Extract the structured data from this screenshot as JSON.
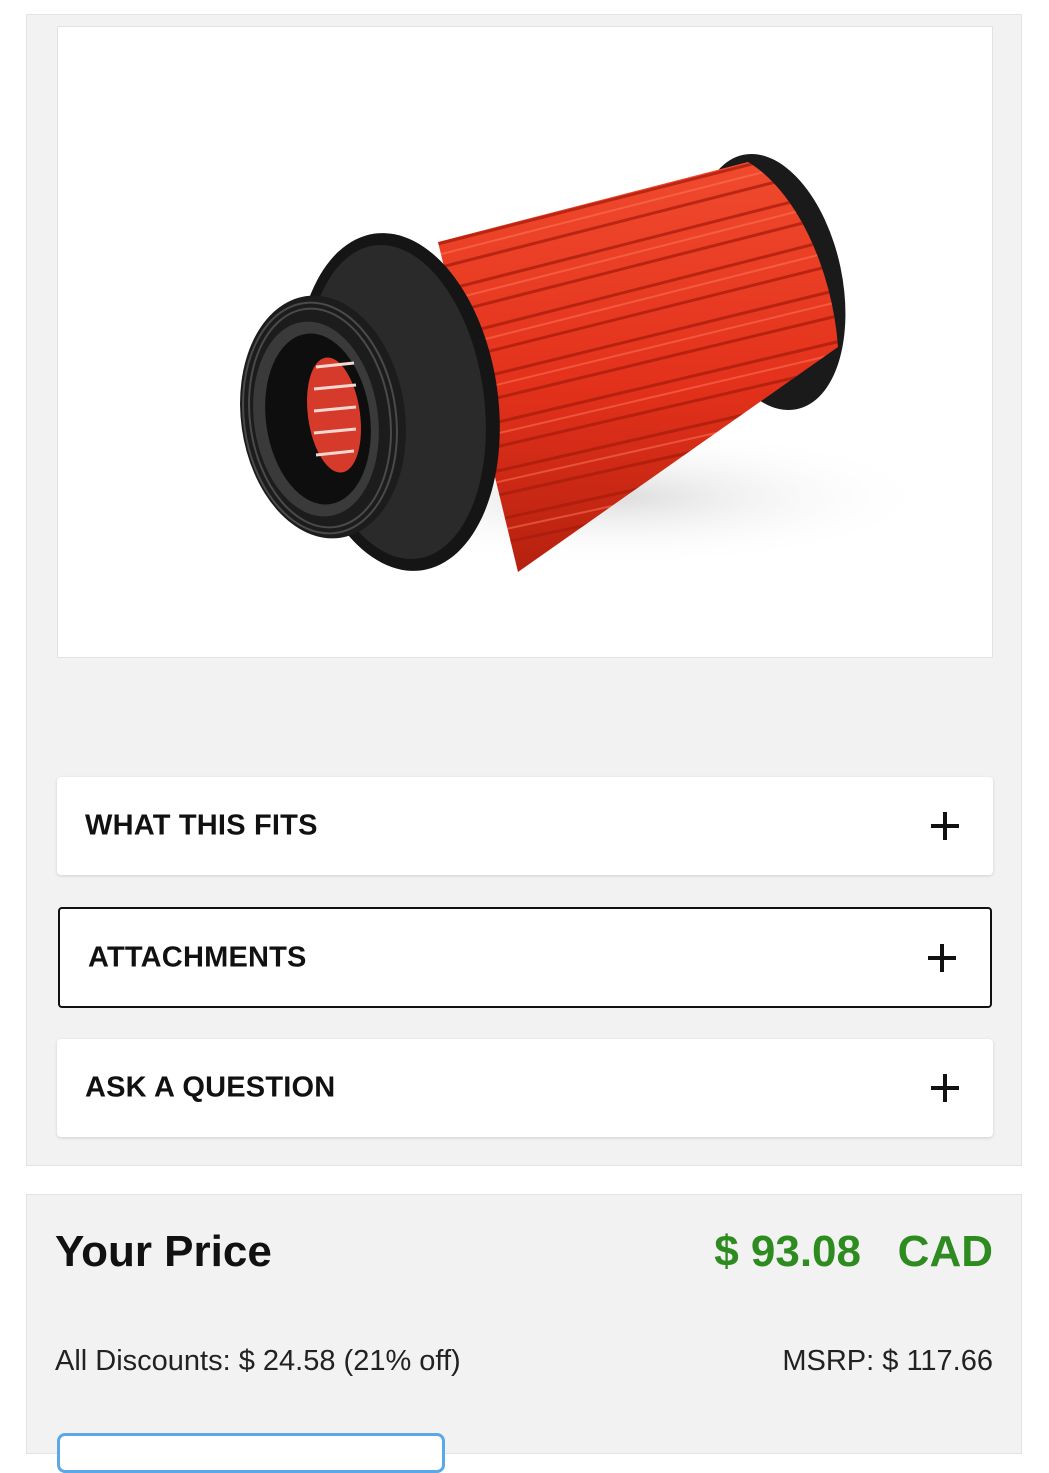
{
  "product": {
    "image_alt": "Red cone air filter",
    "image_icon": "air-filter-product-photo"
  },
  "accordions": {
    "fits": {
      "label": "WHAT THIS FITS",
      "icon": "plus-icon"
    },
    "attachments": {
      "label": "ATTACHMENTS",
      "icon": "plus-icon"
    },
    "question": {
      "label": "ASK A QUESTION",
      "icon": "plus-icon"
    }
  },
  "pricing": {
    "title": "Your Price",
    "price": "$ 93.08   CAD",
    "discounts": "All Discounts: $ 24.58 (21% off)",
    "msrp": "MSRP: $ 117.66"
  },
  "colors": {
    "price_green": "#2e8b1f",
    "panel_bg": "#f2f2f2",
    "filter_red": "#e8331c",
    "focus_outline": "#111111",
    "button_border": "#5aa9e6"
  }
}
